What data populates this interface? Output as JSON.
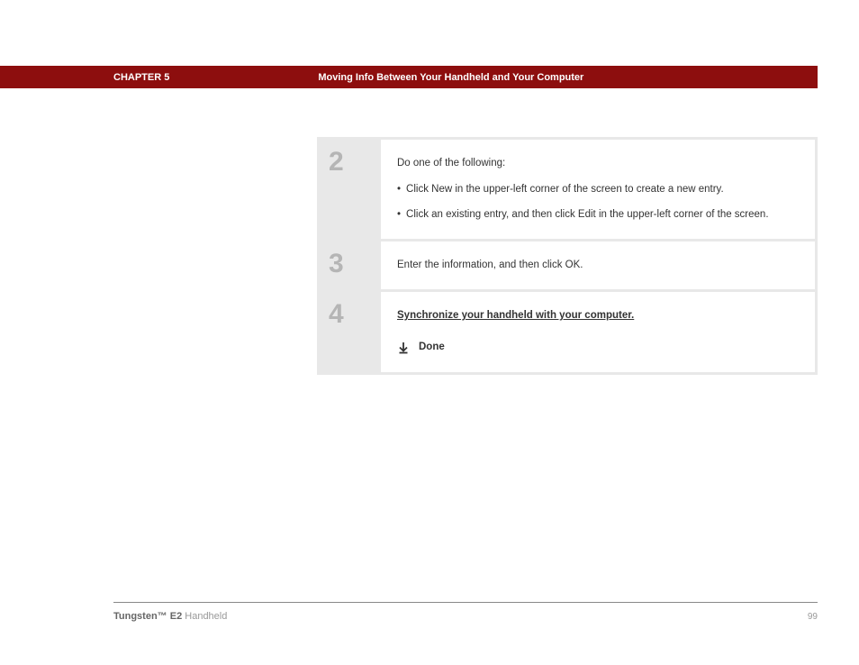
{
  "header": {
    "chapter_label": "CHAPTER 5",
    "chapter_title": "Moving Info Between Your Handheld and Your Computer"
  },
  "steps": {
    "s2": {
      "number": "2",
      "intro": "Do one of the following:",
      "bullet1": "Click New in the upper-left corner of the screen to create a new entry.",
      "bullet2": "Click an existing entry, and then click Edit in the upper-left corner of the screen."
    },
    "s3": {
      "number": "3",
      "text": "Enter the information, and then click OK."
    },
    "s4": {
      "number": "4",
      "link": "Synchronize your handheld with your computer.",
      "done": "Done"
    }
  },
  "footer": {
    "product_bold": "Tungsten™ E2",
    "product_rest": " Handheld",
    "page": "99"
  }
}
